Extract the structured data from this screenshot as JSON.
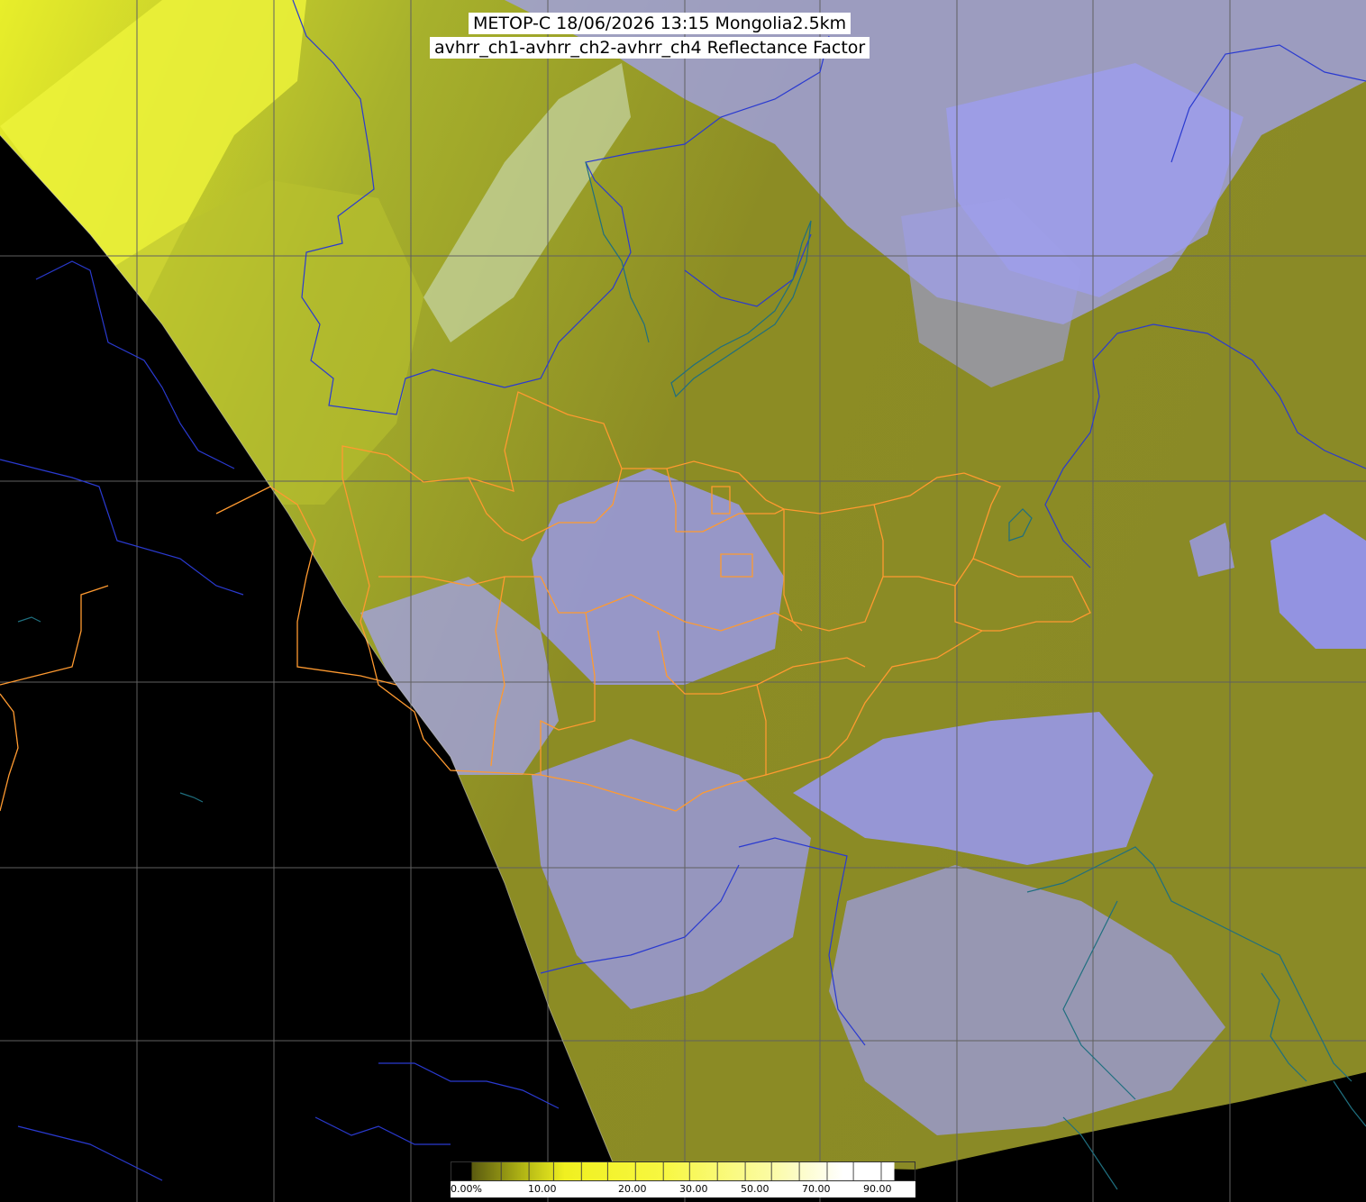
{
  "title": {
    "line1": "METOP-C 18/06/2026 13:15 Mongolia2.5km",
    "line2": "avhrr_ch1-avhrr_ch2-avhrr_ch4 Reflectance Factor"
  },
  "legend": {
    "labels": [
      "0.00%",
      "10.00",
      "20.00",
      "30.00",
      "50.00",
      "70.00",
      "90.00"
    ]
  },
  "colors": {
    "background": "#000000",
    "vegetation": "#8a8a1e",
    "cloud": "#9a9af0",
    "desert": "#d8e02a",
    "grid": "#606060",
    "country_border": "#2a3ad0",
    "coast": "#1f6f7f",
    "mongolia_border": "#ff9a30"
  }
}
